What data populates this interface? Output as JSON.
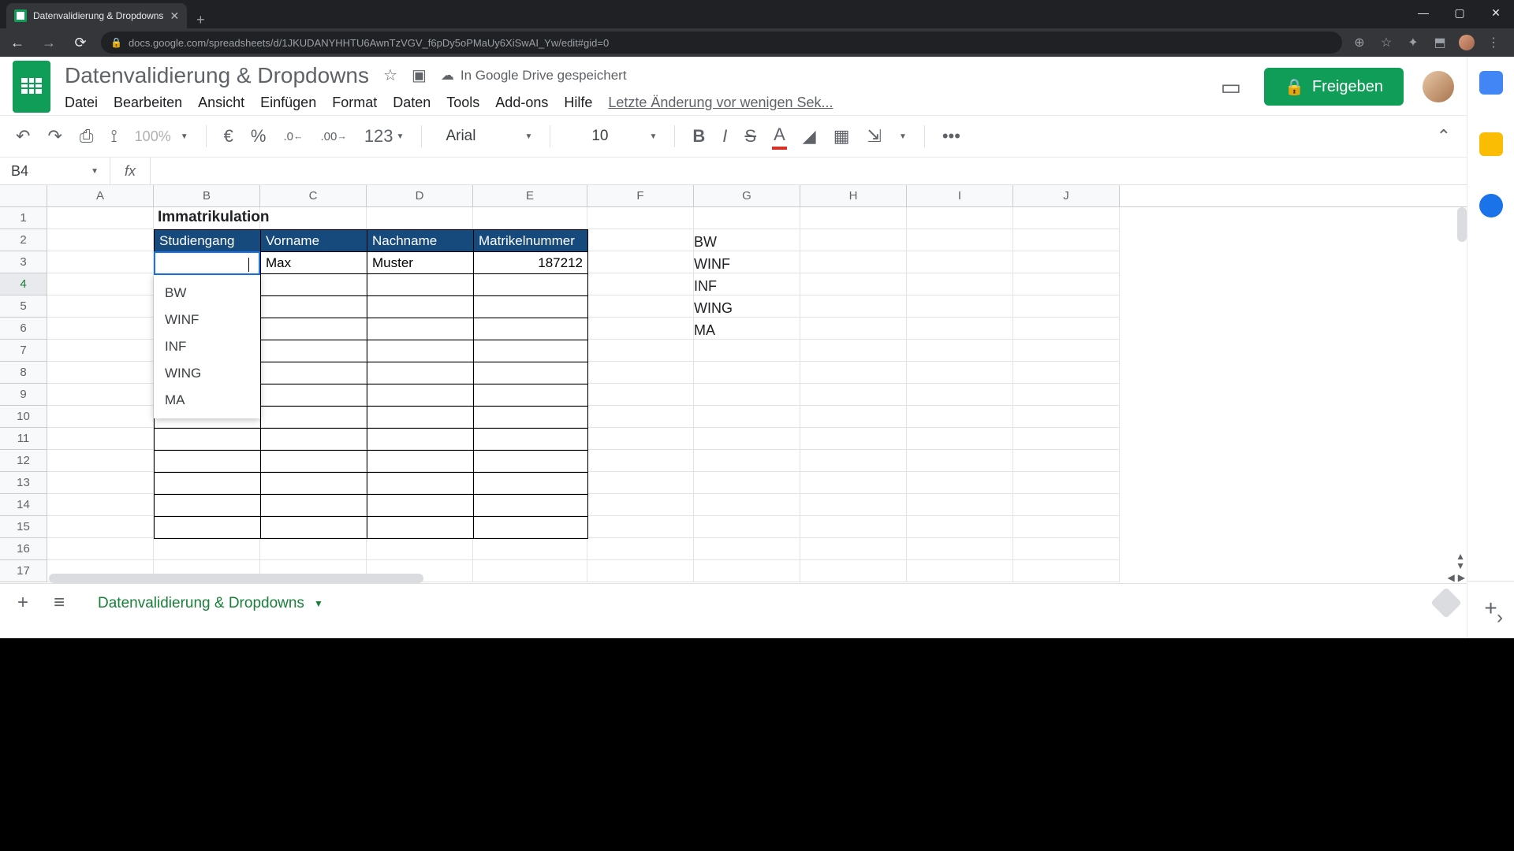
{
  "browser": {
    "tab_title": "Datenvalidierung & Dropdowns",
    "url": "docs.google.com/spreadsheets/d/1JKUDANYHHTU6AwnTzVGV_f6pDy5oPMaUy6XiSwAI_Yw/edit#gid=0"
  },
  "doc": {
    "title": "Datenvalidierung & Dropdowns",
    "saved_status": "In Google Drive gespeichert",
    "last_change": "Letzte Änderung vor wenigen Sek...",
    "share_label": "Freigeben"
  },
  "menu": {
    "datei": "Datei",
    "bearbeiten": "Bearbeiten",
    "ansicht": "Ansicht",
    "einfuegen": "Einfügen",
    "format": "Format",
    "daten": "Daten",
    "tools": "Tools",
    "addons": "Add-ons",
    "hilfe": "Hilfe"
  },
  "toolbar": {
    "zoom": "100%",
    "currency": "€",
    "percent": "%",
    "dec_less": ".0",
    "dec_more": ".00",
    "num_format": "123",
    "font_name": "Arial",
    "font_size": "10",
    "more": "•••"
  },
  "name_box": "B4",
  "columns": [
    "A",
    "B",
    "C",
    "D",
    "E",
    "F",
    "G",
    "H",
    "I",
    "J"
  ],
  "rows": [
    "1",
    "2",
    "3",
    "4",
    "5",
    "6",
    "7",
    "8",
    "9",
    "10",
    "11",
    "12",
    "13",
    "14",
    "15",
    "16",
    "17"
  ],
  "spreadsheet": {
    "title": "Immatrikulation",
    "headers": {
      "b": "Studiengang",
      "c": "Vorname",
      "d": "Nachname",
      "e": "Matrikelnummer"
    },
    "row4": {
      "c": "Max",
      "d": "Muster",
      "e": "187212"
    },
    "validation_values": [
      "BW",
      "WINF",
      "INF",
      "WING",
      "MA"
    ]
  },
  "dropdown": {
    "items": [
      "BW",
      "WINF",
      "INF",
      "WING",
      "MA"
    ]
  },
  "sheet_tab": "Datenvalidierung & Dropdowns"
}
